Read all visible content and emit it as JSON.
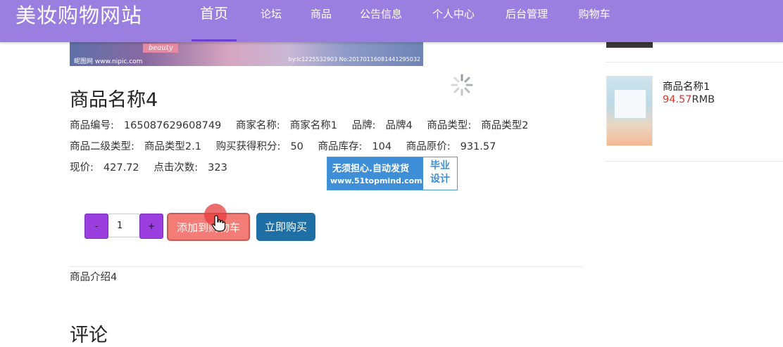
{
  "brand": "美妆购物网站",
  "nav": [
    {
      "label": "首页",
      "active": true
    },
    {
      "label": "论坛"
    },
    {
      "label": "商品"
    },
    {
      "label": "公告信息"
    },
    {
      "label": "个人中心"
    },
    {
      "label": "后台管理"
    },
    {
      "label": "购物车"
    }
  ],
  "banner": {
    "tag": "beauty",
    "watermark_left": "昵图网 www.nipic.com",
    "watermark_right": "by:lc1225532903 No:20170116081441295032"
  },
  "product": {
    "title": "商品名称4",
    "fields": [
      {
        "label": "商品编号:",
        "value": "165087629608749"
      },
      {
        "label": "商家名称:",
        "value": "商家名称1"
      },
      {
        "label": "品牌:",
        "value": "品牌4"
      },
      {
        "label": "商品类型:",
        "value": "商品类型2"
      },
      {
        "label": "商品二级类型:",
        "value": "商品类型2.1"
      },
      {
        "label": "购买获得积分:",
        "value": "50"
      },
      {
        "label": "商品库存:",
        "value": "104"
      },
      {
        "label": "商品原价:",
        "value": "931.57"
      },
      {
        "label": "现价:",
        "value": "427.72"
      },
      {
        "label": "点击次数:",
        "value": "323"
      }
    ],
    "quantity": {
      "minus": "-",
      "value": "1",
      "plus": "+"
    },
    "add_to_cart": "添加到购物车",
    "buy_now": "立即购买",
    "description": "商品介绍4"
  },
  "watermark_badge": {
    "line1": "无须担心.自动发货",
    "line2": "www.51topmind.com",
    "right": "毕业设计"
  },
  "comments_title": "评论",
  "sidebar": {
    "item": {
      "name": "商品名称1",
      "price": "94.57",
      "unit": "RMB"
    }
  },
  "colors": {
    "nav_bg": "#9b7fe0",
    "qty_btn": "#9b3ee0",
    "cart_btn": "#f47c76",
    "buy_btn": "#1e6fa5",
    "price": "#d63a2f"
  }
}
